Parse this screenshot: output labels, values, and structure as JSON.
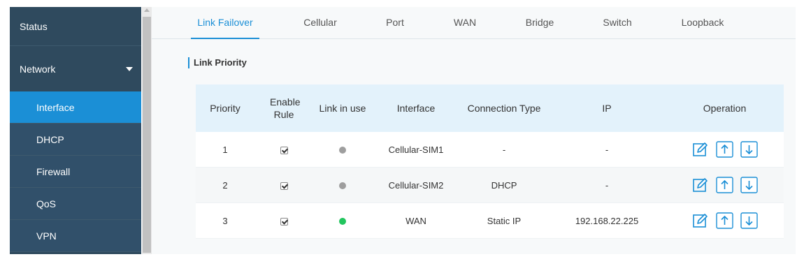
{
  "sidebar": {
    "items": [
      {
        "label": "Status"
      },
      {
        "label": "Network"
      },
      {
        "label": "Interface"
      },
      {
        "label": "DHCP"
      },
      {
        "label": "Firewall"
      },
      {
        "label": "QoS"
      },
      {
        "label": "VPN"
      }
    ]
  },
  "tabs": [
    {
      "label": "Link Failover"
    },
    {
      "label": "Cellular"
    },
    {
      "label": "Port"
    },
    {
      "label": "WAN"
    },
    {
      "label": "Bridge"
    },
    {
      "label": "Switch"
    },
    {
      "label": "Loopback"
    }
  ],
  "section": {
    "title": "Link Priority"
  },
  "table": {
    "headers": [
      "Priority",
      "Enable Rule",
      "Link in use",
      "Interface",
      "Connection Type",
      "IP",
      "Operation"
    ],
    "rows": [
      {
        "priority": "1",
        "enabled": true,
        "link_in_use": false,
        "interface": "Cellular-SIM1",
        "connection_type": "-",
        "ip": "-"
      },
      {
        "priority": "2",
        "enabled": true,
        "link_in_use": false,
        "interface": "Cellular-SIM2",
        "connection_type": "DHCP",
        "ip": "-"
      },
      {
        "priority": "3",
        "enabled": true,
        "link_in_use": true,
        "interface": "WAN",
        "connection_type": "Static IP",
        "ip": "192.168.22.225"
      }
    ],
    "operations": [
      "edit-icon",
      "move-up-icon",
      "move-down-icon"
    ]
  },
  "colors": {
    "sidebar_bg": "#2f4a5e",
    "accent": "#1b8fd6",
    "link_active": "#22c55e",
    "link_inactive": "#9e9e9e"
  }
}
